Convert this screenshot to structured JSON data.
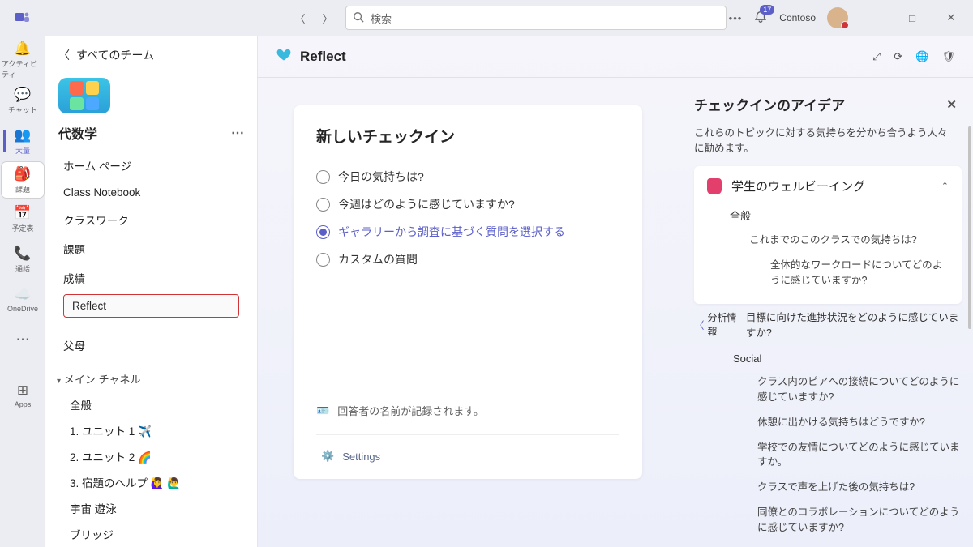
{
  "titlebar": {
    "search_placeholder": "検索",
    "org": "Contoso",
    "notif_count": "17"
  },
  "rail": {
    "activity": "アクティビティ",
    "chat": "チャット",
    "teams": "大量",
    "assignments": "課題",
    "calendar": "予定表",
    "calls": "通話",
    "onedrive": "OneDrive",
    "apps": "Apps"
  },
  "sidebar": {
    "back": "すべてのチーム",
    "team_name": "代数学",
    "links": {
      "home": "ホーム ページ",
      "notebook": "Class Notebook",
      "classwork": "クラスワーク",
      "assignments": "課題",
      "grades": "成績",
      "reflect": "Reflect",
      "parents": "父母"
    },
    "channel_header": "メイン チャネル",
    "channels": {
      "general": "全般",
      "u1": "1. ユニット 1  ✈️",
      "u2": "2. ユニット 2  🌈",
      "u3": "3. 宿題のヘルプ   🙋‍♀️ 🙋‍♂️",
      "u4": "宇宙 遊泳",
      "u5": "ブリッジ"
    }
  },
  "tab": {
    "title": "Reflect"
  },
  "card": {
    "title": "新しいチェックイン",
    "opt1": "今日の気持ちは?",
    "opt2": "今週はどのように感じていますか?",
    "opt3": "ギャラリーから調査に基づく質問を選択する",
    "opt4": "カスタムの質問",
    "note": "回答者の名前が記録されます。",
    "settings": "Settings"
  },
  "ideas": {
    "title": "チェックインのアイデア",
    "sub": "これらのトピックに対する気持ちを分かち合うよう人々に勧めます。",
    "cat1": "学生のウェルビーイング",
    "general": "全般",
    "q1": "これまでのこのクラスでの気持ちは?",
    "q2": "全体的なワークロードについてどのように感じていますか?",
    "aside_link": "目標に向けた進捗状況をどのように感じていますか?",
    "aside_label": "分析情報",
    "social": "Social",
    "s1": "クラス内のピアへの接続についてどのように感じていますか?",
    "s2": "休憩に出かける気持ちはどうですか?",
    "s3": "学校での友情についてどのように感じていますか。",
    "s4": "クラスで声を上げた後の気持ちは?",
    "s5": "同僚とのコラボレーションについてどのように感じていますか?"
  }
}
